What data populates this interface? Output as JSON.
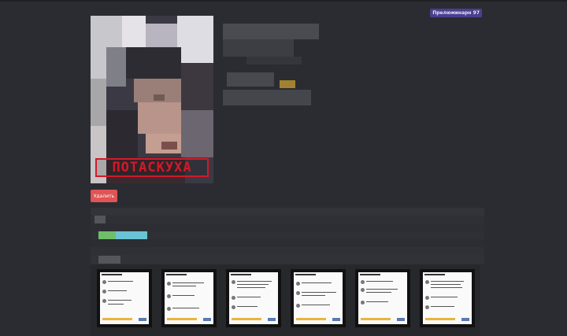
{
  "header": {
    "badge_label": "Прелюминарн 97"
  },
  "profile": {
    "photo_stamp": "ПОТАСКУХА",
    "delete_label": "Удалить"
  },
  "screenshots": {
    "count": 6
  },
  "colors": {
    "background": "#2a2c31",
    "badge": "#4a3f8f",
    "delete_button": "#e05455",
    "stamp": "#d11a2a",
    "accent_green": "#6fbf6a",
    "accent_teal": "#6ac3d4"
  }
}
